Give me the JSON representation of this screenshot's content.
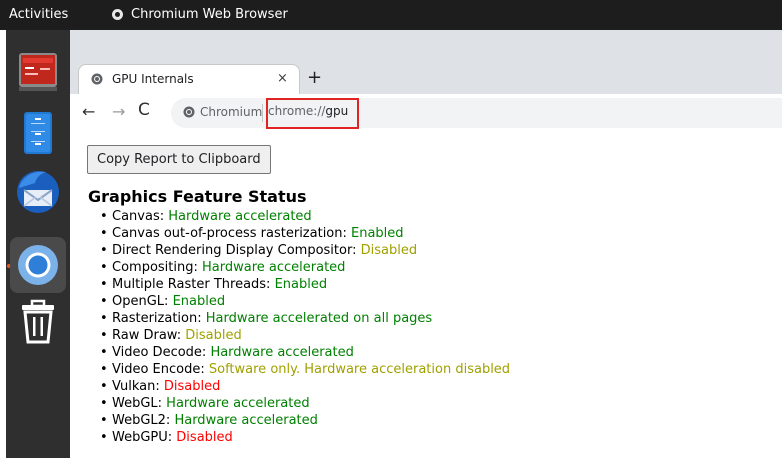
{
  "topbar": {
    "activities": "Activities",
    "app_name": "Chromium Web Browser"
  },
  "dock": {
    "items": [
      {
        "name": "Terminal",
        "icon": "terminal-icon"
      },
      {
        "name": "Files",
        "icon": "files-icon"
      },
      {
        "name": "Thunderbird",
        "icon": "thunderbird-icon"
      },
      {
        "name": "Chromium",
        "icon": "chromium-icon",
        "active": true
      },
      {
        "name": "Trash",
        "icon": "trash-icon"
      }
    ]
  },
  "browser": {
    "tab_title": "GPU Internals",
    "tab_close": "×",
    "new_tab": "+",
    "site_chip": "Chromium",
    "url_scheme": "chrome://",
    "url_host": "gpu"
  },
  "page": {
    "copy_button": "Copy Report to Clipboard",
    "heading": "Graphics Feature Status",
    "features": [
      {
        "name": "Canvas: ",
        "status": "Hardware accelerated",
        "state": "enabled"
      },
      {
        "name": "Canvas out-of-process rasterization: ",
        "status": "Enabled",
        "state": "enabled"
      },
      {
        "name": "Direct Rendering Display Compositor: ",
        "status": "Disabled",
        "state": "warning"
      },
      {
        "name": "Compositing: ",
        "status": "Hardware accelerated",
        "state": "enabled"
      },
      {
        "name": "Multiple Raster Threads: ",
        "status": "Enabled",
        "state": "enabled"
      },
      {
        "name": "OpenGL: ",
        "status": "Enabled",
        "state": "enabled"
      },
      {
        "name": "Rasterization: ",
        "status": "Hardware accelerated on all pages",
        "state": "enabled"
      },
      {
        "name": "Raw Draw: ",
        "status": "Disabled",
        "state": "warning"
      },
      {
        "name": "Video Decode: ",
        "status": "Hardware accelerated",
        "state": "enabled"
      },
      {
        "name": "Video Encode: ",
        "status": "Software only. Hardware acceleration disabled",
        "state": "warning"
      },
      {
        "name": "Vulkan: ",
        "status": "Disabled",
        "state": "disabled"
      },
      {
        "name": "WebGL: ",
        "status": "Hardware accelerated",
        "state": "enabled"
      },
      {
        "name": "WebGL2: ",
        "status": "Hardware accelerated",
        "state": "enabled"
      },
      {
        "name": "WebGPU: ",
        "status": "Disabled",
        "state": "disabled"
      }
    ]
  },
  "colors": {
    "enabled": "#008000",
    "disabled": "#ff0000",
    "warning": "#a0a000",
    "highlight": "#e02424"
  }
}
